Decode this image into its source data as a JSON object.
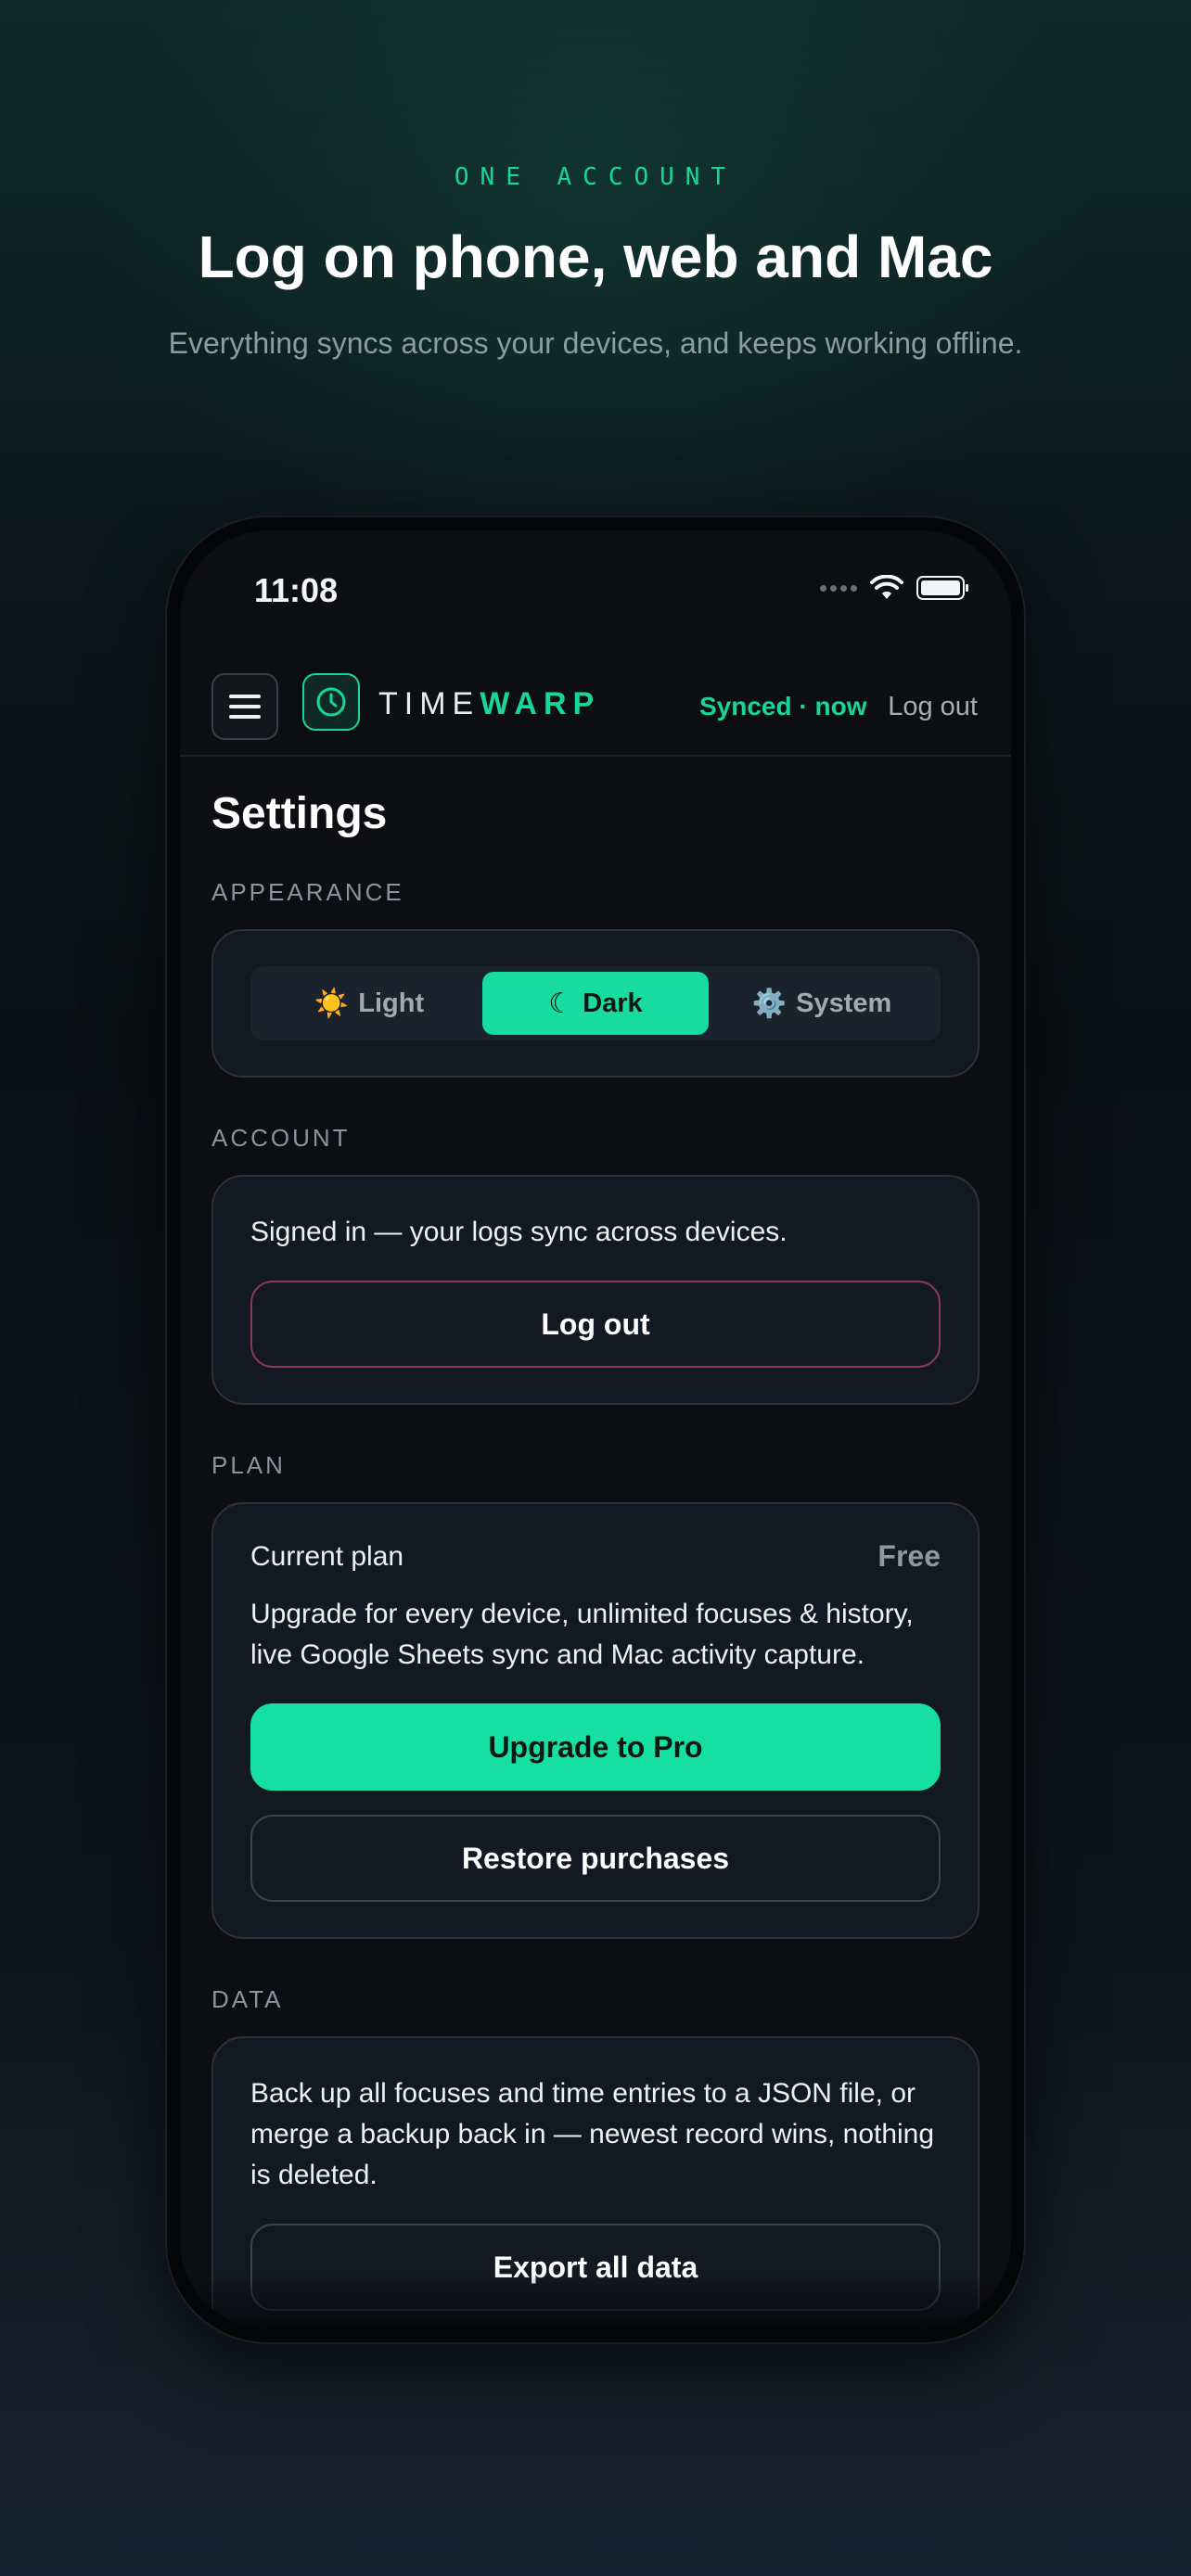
{
  "hero": {
    "eyebrow": "ONE ACCOUNT",
    "title": "Log on phone, web and Mac",
    "subtitle": "Everything syncs across your devices, and keeps working offline."
  },
  "statusbar": {
    "time": "11:08",
    "icons": [
      "cellular-icon",
      "wifi-icon",
      "battery-icon"
    ]
  },
  "appbar": {
    "logo_left": "TIME",
    "logo_right": "WARP",
    "sync_status": "Synced · now",
    "logout_label": "Log out"
  },
  "settings": {
    "title": "Settings",
    "appearance": {
      "label": "APPEARANCE",
      "options": [
        {
          "glyph": "☀️",
          "label": "Light"
        },
        {
          "glyph": "☾",
          "label": "Dark"
        },
        {
          "glyph": "⚙️",
          "label": "System"
        }
      ],
      "selected": "Dark"
    },
    "account": {
      "label": "ACCOUNT",
      "text": "Signed in — your logs sync across devices.",
      "button": "Log out"
    },
    "plan": {
      "label": "PLAN",
      "current_label": "Current plan",
      "current_value": "Free",
      "description": "Upgrade for every device, unlimited focuses & history, live Google Sheets sync and Mac activity capture.",
      "upgrade_button": "Upgrade to Pro",
      "restore_button": "Restore purchases"
    },
    "data": {
      "label": "DATA",
      "text": "Back up all focuses and time entries to a JSON file, or merge a backup back in — newest record wins, nothing is deleted.",
      "export_button": "Export all data"
    }
  },
  "colors": {
    "accent": "#18d69b",
    "background": "#0c0e12",
    "card": "#131922",
    "danger_border": "#8a3a52"
  }
}
